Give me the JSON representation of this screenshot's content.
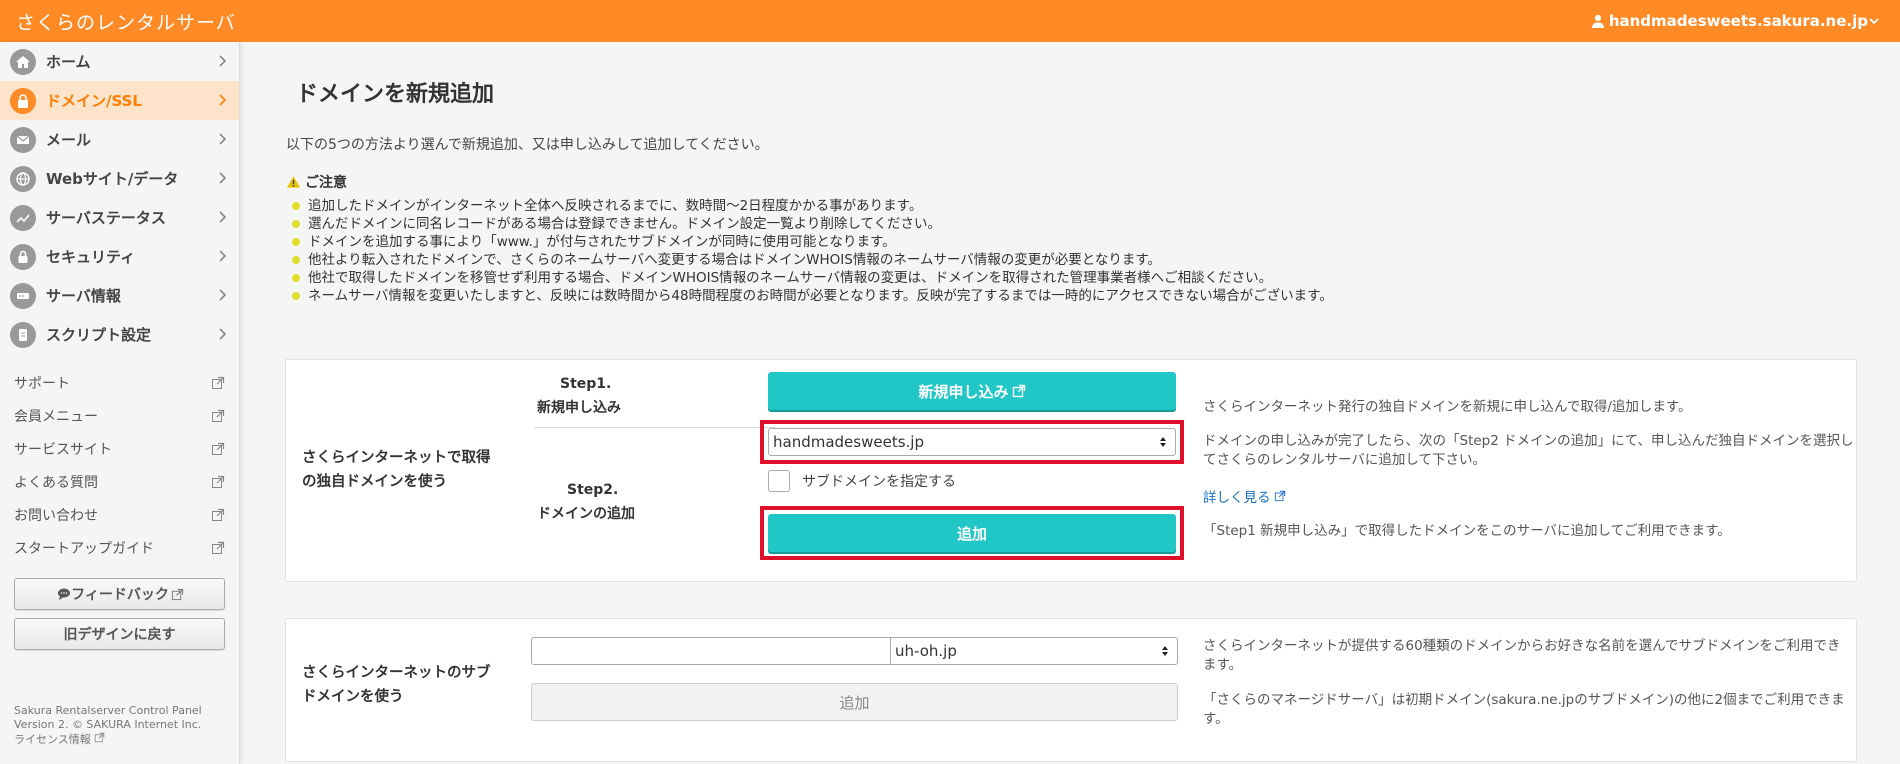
{
  "header": {
    "brand": "さくらのレンタルサーバ",
    "account": "handmadesweets.sakura.ne.jp"
  },
  "sidebar": {
    "nav": [
      {
        "label": "ホーム",
        "icon": "home-icon"
      },
      {
        "label": "ドメイン/SSL",
        "icon": "lock-icon",
        "active": true
      },
      {
        "label": "メール",
        "icon": "mail-icon"
      },
      {
        "label": "Webサイト/データ",
        "icon": "globe-icon"
      },
      {
        "label": "サーバステータス",
        "icon": "chart-icon"
      },
      {
        "label": "セキュリティ",
        "icon": "padlock-icon"
      },
      {
        "label": "サーバ情報",
        "icon": "server-icon"
      },
      {
        "label": "スクリプト設定",
        "icon": "script-icon"
      }
    ],
    "links": [
      "サポート",
      "会員メニュー",
      "サービスサイト",
      "よくある質問",
      "お問い合わせ",
      "スタートアップガイド"
    ],
    "feedback_label": "フィードバック",
    "old_design_label": "旧デザインに戻す",
    "footer_line1": "Sakura Rentalserver Control Panel",
    "footer_line2": "Version 2. © SAKURA Internet Inc.",
    "footer_line3": "ライセンス情報"
  },
  "main": {
    "title": "ドメインを新規追加",
    "intro": "以下の5つの方法より選んで新規追加、又は申し込みして追加してください。",
    "notice_title": "ご注意",
    "notices": [
      "追加したドメインがインターネット全体へ反映されるまでに、数時間〜2日程度かかる事があります。",
      "選んだドメインに同名レコードがある場合は登録できません。ドメイン設定一覧より削除してください。",
      "ドメインを追加する事により「www.」が付与されたサブドメインが同時に使用可能となります。",
      "他社より転入されたドメインで、さくらのネームサーバへ変更する場合はドメインWHOIS情報のネームサーバ情報の変更が必要となります。",
      "他社で取得したドメインを移管せず利用する場合、ドメインWHOIS情報のネームサーバ情報の変更は、ドメインを取得された管理事業者様へご相談ください。",
      "ネームサーバ情報を変更いたしますと、反映には数時間から48時間程度のお時間が必要となります。反映が完了するまでは一時的にアクセスできない場合がございます。"
    ],
    "card1": {
      "label_line1": "さくらインターネットで取得",
      "label_line2": "の独自ドメインを使う",
      "step1_line1": "Step1.",
      "step1_line2": "新規申し込み",
      "step2_line1": "Step2.",
      "step2_line2": "ドメインの追加",
      "apply_button": "新規申し込み",
      "domain_select_value": "handmadesweets.jp",
      "subdomain_checkbox_label": "サブドメインを指定する",
      "add_button": "追加",
      "desc1": "さくらインターネット発行の独自ドメインを新規に申し込んで取得/追加します。",
      "desc2_line1": "ドメインの申し込みが完了したら、次の「Step2 ドメインの追加」にて、申し込んだ独自ドメインを選択し",
      "desc2_line2": "てさくらのレンタルサーバに追加して下さい。",
      "more_link": "詳しく見る",
      "desc3": "「Step1 新規申し込み」で取得したドメインをこのサーバに追加してご利用できます。"
    },
    "card2": {
      "label_line1": "さくらインターネットのサブ",
      "label_line2": "ドメインを使う",
      "subdomain_input_value": "",
      "domain_select_value": "uh-oh.jp",
      "add_button": "追加",
      "desc1_line1": "さくらインターネットが提供する60種類のドメインからお好きな名前を選んでサブドメインをご利用でき",
      "desc1_line2": "ます。",
      "desc2_line1": "「さくらのマネージドサーバ」は初期ドメイン(sakura.ne.jpのサブドメイン)の他に2個までご利用できま",
      "desc2_line2": "す。"
    }
  },
  "colors": {
    "header": "#ff8a26",
    "accent_teal": "#21c7c7",
    "highlight_red": "#e0102a",
    "active_nav_bg": "#fde3c9"
  }
}
